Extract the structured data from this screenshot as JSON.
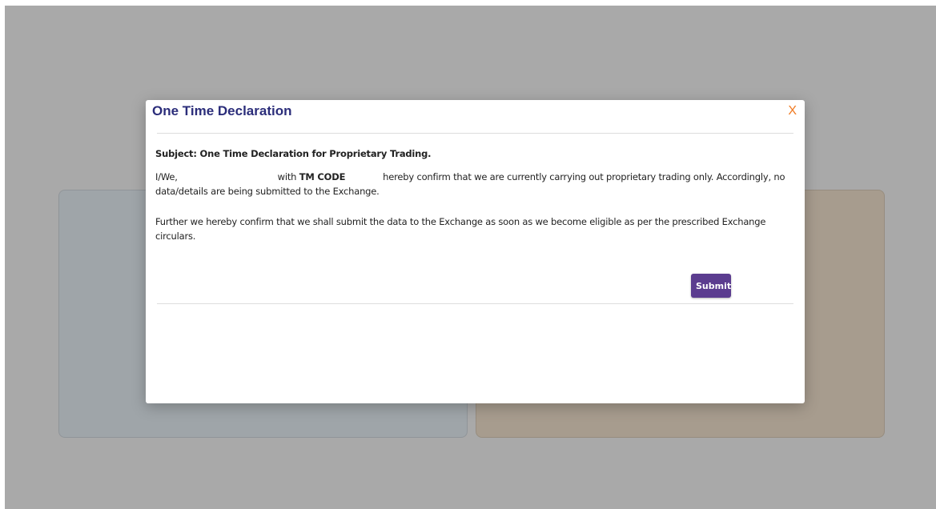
{
  "modal": {
    "title": "One Time Declaration",
    "close_label": "X",
    "subject": "Subject: One Time Declaration for Proprietary Trading.",
    "para1_prefix": "I/We,",
    "para1_with": "with",
    "para1_tm_code": "TM CODE",
    "para1_suffix": "hereby confirm that we are currently carrying out proprietary trading only. Accordingly, no data/details are being submitted to the Exchange.",
    "para2": "Further we hereby confirm that we shall submit the data to the Exchange as soon as we become eligible as per the prescribed Exchange circulars.",
    "submit_label": "Submit"
  },
  "colors": {
    "title": "#2b2d7a",
    "close": "#f07a22",
    "submit_bg": "#5b3c8f",
    "left_card": "#e4ecf2",
    "right_card": "#efe0cc"
  }
}
